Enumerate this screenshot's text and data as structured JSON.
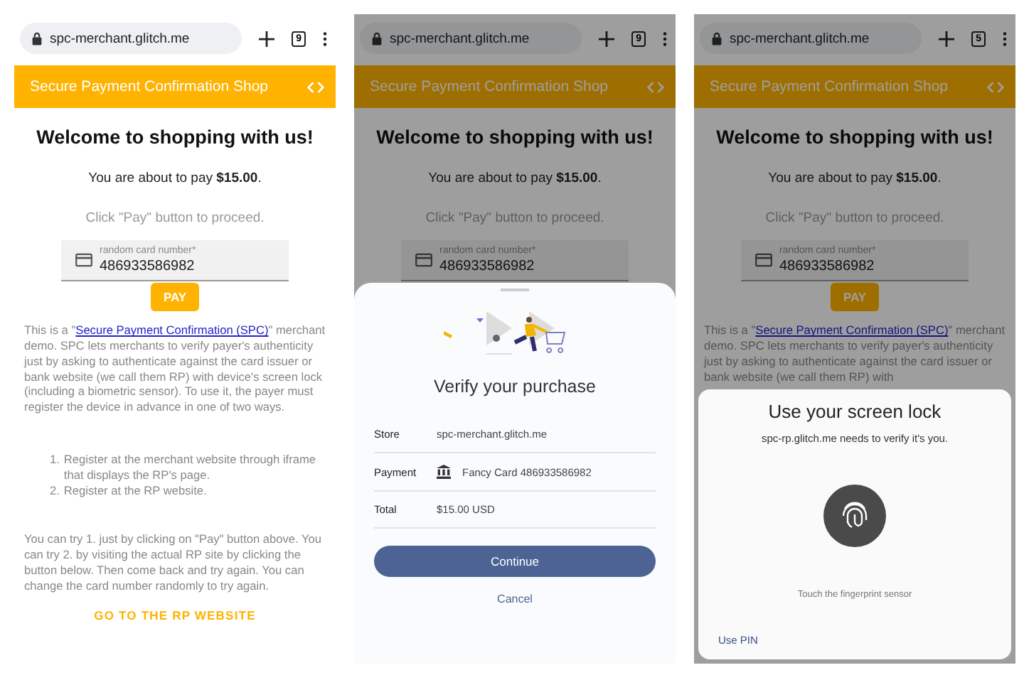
{
  "screens": [
    {
      "dimmed": false,
      "browser": {
        "url": "spc-merchant.glitch.me",
        "tab_count": "9"
      },
      "header": {
        "title": "Secure Payment Confirmation Shop"
      },
      "page": [
        {
          "kind": "heading",
          "text": "Welcome to shopping with us!"
        },
        {
          "kind": "amount",
          "before": "You are about to pay ",
          "amount": "$15.00",
          "after": "."
        },
        {
          "kind": "hint",
          "text": "Click \"Pay\" button to proceed."
        },
        {
          "kind": "card_field",
          "label": "random card number*",
          "value": "486933586982"
        },
        {
          "kind": "pay_button",
          "text": "PAY"
        },
        {
          "kind": "paragraph",
          "before": "This is a \"",
          "link": "Secure Payment Confirmation (SPC)",
          "after": "\" merchant demo. SPC lets merchants to verify payer's authenticity just by asking to authenticate against the card issuer or bank website (we call them RP) with device's screen lock (including a biometric sensor). To use it, the payer must register the device in advance in one of two ways."
        },
        {
          "kind": "list",
          "items": [
            {
              "number": "1.",
              "text": "Register at the merchant website through iframe that displays the RP's page."
            },
            {
              "number": "2.",
              "text": "Register at the RP website."
            }
          ]
        },
        {
          "kind": "text",
          "text": "You can try 1. just by clicking on \"Pay\" button above. You can try 2. by visiting the actual RP site by clicking the button below. Then come back and try again. You can change the card number randomly to try again."
        },
        {
          "kind": "text_button",
          "text": "GO TO THE RP WEBSITE"
        }
      ]
    },
    {
      "dimmed": true,
      "browser": {
        "url": "spc-merchant.glitch.me",
        "tab_count": "9"
      },
      "header": {
        "title": "Secure Payment Confirmation Shop"
      },
      "page": [
        {
          "kind": "heading",
          "text": "Welcome to shopping with us!"
        },
        {
          "kind": "amount",
          "before": "You are about to pay ",
          "amount": "$15.00",
          "after": "."
        },
        {
          "kind": "hint",
          "text": "Click \"Pay\" button to proceed."
        },
        {
          "kind": "card_field",
          "label": "random card number*",
          "value": "486933586982"
        }
      ],
      "sheet": {
        "kind": "payment",
        "title": "Verify your purchase",
        "rows": [
          {
            "label": "Store",
            "value": "spc-merchant.glitch.me",
            "bank_icon": false
          },
          {
            "label": "Payment",
            "value": "Fancy Card 486933586982",
            "bank_icon": true
          },
          {
            "label": "Total",
            "value": "$15.00 USD",
            "bank_icon": false
          }
        ],
        "primary": "Continue",
        "secondary": "Cancel"
      }
    },
    {
      "dimmed": true,
      "browser": {
        "url": "spc-merchant.glitch.me",
        "tab_count": "5"
      },
      "header": {
        "title": "Secure Payment Confirmation Shop"
      },
      "page": [
        {
          "kind": "heading",
          "text": "Welcome to shopping with us!"
        },
        {
          "kind": "amount",
          "before": "You are about to pay ",
          "amount": "$15.00",
          "after": "."
        },
        {
          "kind": "hint",
          "text": "Click \"Pay\" button to proceed."
        },
        {
          "kind": "card_field",
          "label": "random card number*",
          "value": "486933586982"
        },
        {
          "kind": "pay_button",
          "text": "PAY"
        },
        {
          "kind": "paragraph",
          "before": "This is a \"",
          "link": "Secure Payment Confirmation (SPC)",
          "after": "\" merchant demo. SPC lets merchants to verify payer's authenticity just by asking to authenticate against the card issuer or bank website (we call them RP) with"
        }
      ],
      "sheet": {
        "kind": "screen_lock",
        "title": "Use your screen lock",
        "subtitle": "spc-rp.glitch.me needs to verify it's you.",
        "hint": "Touch the fingerprint sensor",
        "secondary": "Use PIN"
      }
    }
  ]
}
